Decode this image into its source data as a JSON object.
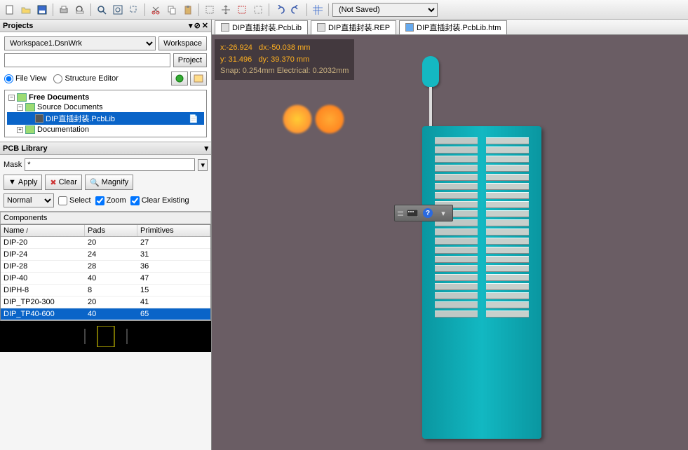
{
  "toolbar": {
    "saved_state": "(Not Saved)"
  },
  "projects": {
    "title": "Projects",
    "workspace_value": "Workspace1.DsnWrk",
    "workspace_btn": "Workspace",
    "project_btn": "Project",
    "file_view": "File View",
    "structure_editor": "Structure Editor",
    "tree": {
      "root": "Free Documents",
      "src": "Source Documents",
      "file": "DIP直插封装.PcbLib",
      "doc": "Documentation"
    }
  },
  "pcblib": {
    "title": "PCB Library",
    "mask_label": "Mask",
    "mask_value": "*",
    "apply": "Apply",
    "clear": "Clear",
    "magnify": "Magnify",
    "mode": "Normal",
    "select": "Select",
    "zoom": "Zoom",
    "clear_existing": "Clear Existing",
    "components_label": "Components",
    "headers": {
      "name": "Name",
      "pads": "Pads",
      "prim": "Primitives"
    },
    "rows": [
      {
        "name": "DIP-20",
        "pads": "20",
        "prim": "27"
      },
      {
        "name": "DIP-24",
        "pads": "24",
        "prim": "31"
      },
      {
        "name": "DIP-28",
        "pads": "28",
        "prim": "36"
      },
      {
        "name": "DIP-40",
        "pads": "40",
        "prim": "47"
      },
      {
        "name": "DIPH-8",
        "pads": "8",
        "prim": "15"
      },
      {
        "name": "DIP_TP20-300",
        "pads": "20",
        "prim": "41"
      },
      {
        "name": "DIP_TP40-600",
        "pads": "40",
        "prim": "65"
      }
    ]
  },
  "tabs": [
    "DIP直插封装.PcbLib",
    "DIP直插封装.REP",
    "DIP直插封装.PcbLib.htm"
  ],
  "coord": {
    "x": "x:-26.924",
    "dx": "dx:-50.038 mm",
    "y": "y: 31.496",
    "dy": "dy: 39.370 mm",
    "snap": "Snap: 0.254mm Electrical: 0.2032mm"
  }
}
